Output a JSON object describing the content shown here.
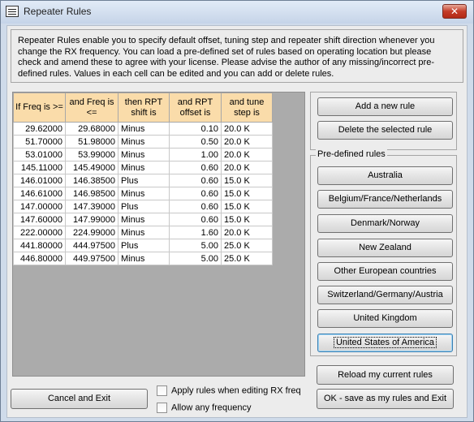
{
  "window": {
    "title": "Repeater Rules",
    "close_glyph": "✕"
  },
  "intro": {
    "text": "Repeater Rules enable you to specify default offset, tuning step and repeater shift direction whenever you change the RX frequency.  You can load a pre-defined set of rules based on operating location but please check and amend these to agree with your license.  Please advise the author of any missing/incorrect pre-defined rules.  Values in each cell can be edited and you can add or delete rules."
  },
  "table": {
    "headers": [
      "If Freq is >=",
      "and Freq is <=",
      "then RPT shift is",
      "and RPT offset is",
      "and tune step is"
    ],
    "rows": [
      [
        "29.62000",
        "29.68000",
        "Minus",
        "0.10",
        "20.0 K"
      ],
      [
        "51.70000",
        "51.98000",
        "Minus",
        "0.50",
        "20.0 K"
      ],
      [
        "53.01000",
        "53.99000",
        "Minus",
        "1.00",
        "20.0 K"
      ],
      [
        "145.11000",
        "145.49000",
        "Minus",
        "0.60",
        "20.0 K"
      ],
      [
        "146.01000",
        "146.38500",
        "Plus",
        "0.60",
        "15.0 K"
      ],
      [
        "146.61000",
        "146.98500",
        "Minus",
        "0.60",
        "15.0 K"
      ],
      [
        "147.00000",
        "147.39000",
        "Plus",
        "0.60",
        "15.0 K"
      ],
      [
        "147.60000",
        "147.99000",
        "Minus",
        "0.60",
        "15.0 K"
      ],
      [
        "222.00000",
        "224.99000",
        "Minus",
        "1.60",
        "20.0 K"
      ],
      [
        "441.80000",
        "444.97500",
        "Plus",
        "5.00",
        "25.0 K"
      ],
      [
        "446.80000",
        "449.97500",
        "Minus",
        "5.00",
        "25.0 K"
      ]
    ]
  },
  "rule_buttons": {
    "add": "Add a new rule",
    "delete": "Delete the selected rule"
  },
  "predefined": {
    "legend": "Pre-defined rules",
    "items": [
      "Australia",
      "Belgium/France/Netherlands",
      "Denmark/Norway",
      "New Zealand",
      "Other European countries",
      "Switzerland/Germany/Austria",
      "United Kingdom",
      "United States of America"
    ]
  },
  "footer": {
    "cancel": "Cancel and Exit",
    "apply_rules": "Apply rules when editing RX freq",
    "allow_any": "Allow any frequency",
    "reload": "Reload my current rules",
    "ok": "OK - save as my rules and Exit"
  }
}
